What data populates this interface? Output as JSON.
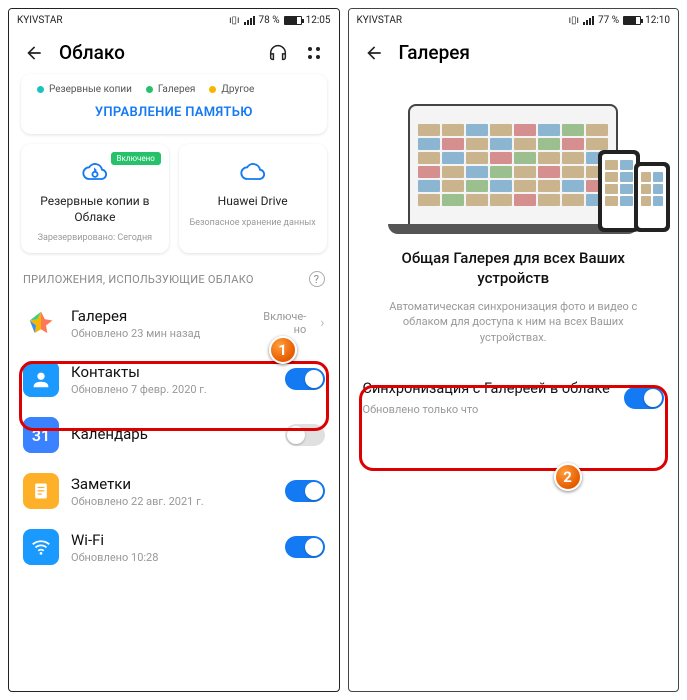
{
  "left": {
    "status": {
      "carrier": "KYIVSTAR",
      "battery_pct": "78 %",
      "time": "12:05"
    },
    "nav_title": "Облако",
    "legend": {
      "a": {
        "color": "#18c4bc",
        "label": "Резервные копии"
      },
      "b": {
        "color": "#25c26b",
        "label": "Галерея"
      },
      "c": {
        "color": "#f7b500",
        "label": "Другое"
      }
    },
    "manage_memory": "УПРАВЛЕНИЕ ПАМЯТЬЮ",
    "tiles": {
      "backup": {
        "badge": "Включено",
        "label": "Резервные копии в Облаке",
        "foot": "Зарезервировано: Сегодня"
      },
      "drive": {
        "label": "Huawei Drive",
        "foot": "Безопасное хранение данных"
      }
    },
    "section_header": "ПРИЛОЖЕНИЯ, ИСПОЛЬЗУЮЩИЕ ОБЛАКО",
    "apps": {
      "gallery": {
        "title": "Галерея",
        "sub": "Обновлено 23 мин назад",
        "state": "Включе-\nно"
      },
      "contacts": {
        "title": "Контакты",
        "sub": "Обновлено 7 февр. 2020 г."
      },
      "calendar": {
        "title": "Календарь",
        "sub": ""
      },
      "notes": {
        "title": "Заметки",
        "sub": "Обновлено 22 авг. 2021 г."
      },
      "wifi": {
        "title": "Wi-Fi",
        "sub": "Обновлено 10:28"
      }
    },
    "badge_num": "1"
  },
  "right": {
    "status": {
      "carrier": "KYIVSTAR",
      "battery_pct": "77 %",
      "time": "12:10"
    },
    "nav_title": "Галерея",
    "hero_title": "Общая Галерея для всех Ваших устройств",
    "hero_sub": "Автоматическая синхронизация фото и видео с облаком для доступа к ним на всех Ваших устройствах.",
    "sync": {
      "title": "Синхронизация с Галереей в облаке",
      "sub": "Обновлено только что"
    },
    "badge_num": "2"
  }
}
